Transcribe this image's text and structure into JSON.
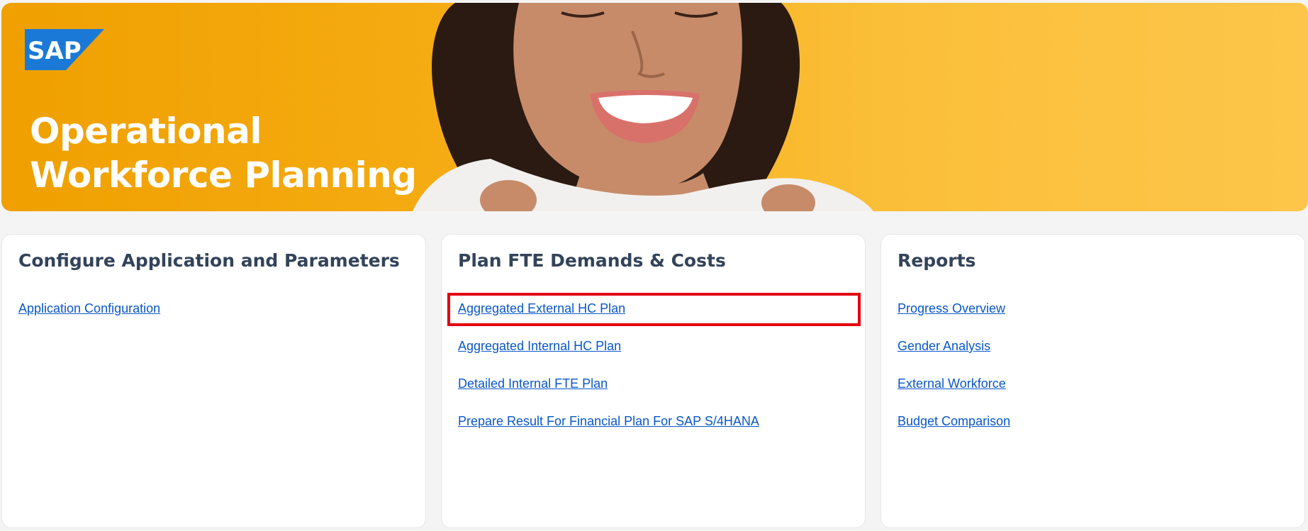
{
  "banner": {
    "logo_text": "SAP",
    "title_line1": "Operational",
    "title_line2": "Workforce Planning"
  },
  "colors": {
    "banner_orange": "#f5a800",
    "banner_yellow": "#fdc64a",
    "card_title": "#33435a",
    "link": "#0a57c7",
    "highlight": "#e3000f",
    "sap_blue": "#1a79d6"
  },
  "cards": [
    {
      "title": "Configure Application and Parameters",
      "links": [
        "Application Configuration"
      ]
    },
    {
      "title": "Plan FTE Demands & Costs",
      "links": [
        "Aggregated External HC Plan",
        "Aggregated Internal HC Plan",
        "Detailed Internal FTE Plan",
        "Prepare Result For Financial Plan For SAP S/4HANA"
      ],
      "highlighted_link": "Aggregated External HC Plan"
    },
    {
      "title": "Reports",
      "links": [
        "Progress Overview",
        "Gender Analysis",
        "External Workforce",
        "Budget Comparison"
      ]
    }
  ]
}
